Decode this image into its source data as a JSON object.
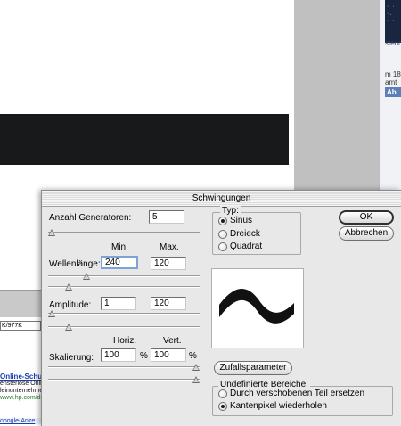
{
  "background": {
    "right_panel": {
      "tagline": "stenc",
      "line1": "m 18",
      "line2": "amt",
      "tab_label": "Ab"
    },
    "status_field": "K/977K",
    "ad": {
      "title": "Online-Schulu",
      "line1": "ensterlose Onlin",
      "line2": "leinunternehme",
      "url": "www.hp.com/de/",
      "footer": "ooogle-Anze"
    }
  },
  "dialog": {
    "title": "Schwingungen",
    "generators": {
      "label": "Anzahl Generatoren:",
      "value": "5",
      "slider_fraction": 0.0
    },
    "col_min": "Min.",
    "col_max": "Max.",
    "wavelength": {
      "label": "Wellenlänge:",
      "min": "240",
      "max": "120",
      "slider_min_fraction": 0.24,
      "slider_max_fraction": 0.12
    },
    "amplitude": {
      "label": "Amplitude:",
      "min": "1",
      "max": "120",
      "slider_min_fraction": 0.0,
      "slider_max_fraction": 0.12
    },
    "col_horiz": "Horiz.",
    "col_vert": "Vert.",
    "scaling": {
      "label": "Skalierung:",
      "horiz": "100",
      "vert": "100",
      "unit": "%",
      "slider_horiz_fraction": 1.0,
      "slider_vert_fraction": 1.0
    },
    "type_group": {
      "label": "Typ:",
      "options": [
        "Sinus",
        "Dreieck",
        "Quadrat"
      ],
      "selected": "Sinus"
    },
    "ok_label": "OK",
    "cancel_label": "Abbrechen",
    "randomize_label": "Zufallsparameter",
    "undefined_group": {
      "label": "Undefinierte Bereiche:",
      "options": [
        "Durch verschobenen Teil ersetzen",
        "Kantenpixel wiederholen"
      ],
      "selected": "Kantenpixel wiederholen"
    }
  }
}
